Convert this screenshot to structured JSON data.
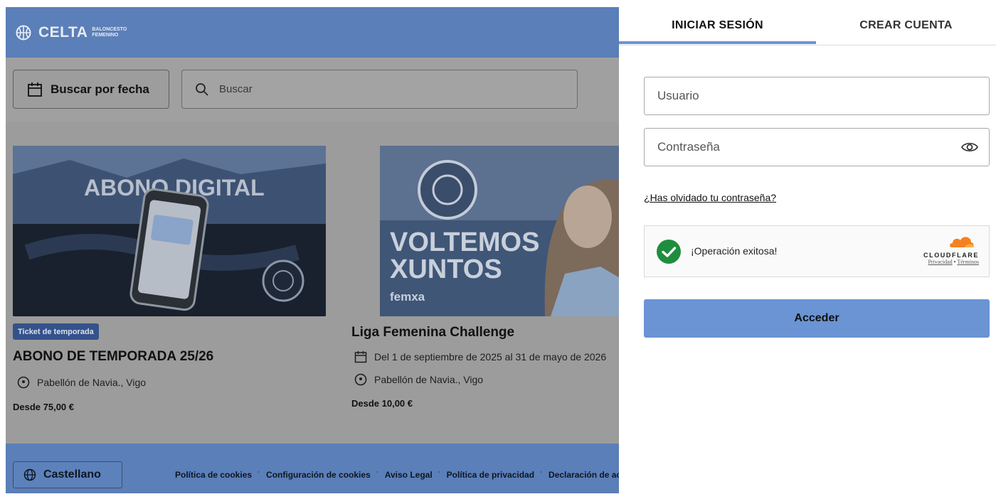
{
  "header": {
    "logo_word": "CELTA",
    "logo_sub1": "BALONCESTO",
    "logo_sub2": "FEMENINO"
  },
  "search": {
    "date_button": "Buscar por fecha",
    "placeholder": "Buscar"
  },
  "card1": {
    "image_text": "ABONO DIGITAL",
    "badge": "Ticket de temporada",
    "title": "ABONO DE TEMPORADA 25/26",
    "location": "Pabellón de Navia., Vigo",
    "price": "Desde 75,00 €"
  },
  "card2": {
    "image_text1": "VOLTEMOS",
    "image_text2": "XUNTOS",
    "image_brand": "femxa",
    "title": "Liga Femenina Challenge",
    "dates": "Del 1 de septiembre de 2025 al 31 de mayo de 2026",
    "location": "Pabellón de Navia., Vigo",
    "price": "Desde 10,00 €"
  },
  "footer": {
    "language": "Castellano",
    "links": [
      "Política de cookies",
      "Configuración de cookies",
      "Aviso Legal",
      "Política de privacidad",
      "Declaración de accesibilidad"
    ],
    "separator": "˙"
  },
  "panel": {
    "tab_login": "INICIAR SESIÓN",
    "tab_register": "CREAR CUENTA",
    "username_placeholder": "Usuario",
    "password_placeholder": "Contraseña",
    "forgot_prefix": "¿",
    "forgot_link": "Has olvidado tu contraseña?",
    "captcha_status": "¡Operación exitosa!",
    "captcha_brand": "CLOUDFLARE",
    "captcha_privacy": "Privacidad",
    "captcha_dot": "•",
    "captcha_terms": "Términos",
    "submit": "Acceder"
  },
  "colors": {
    "overlay_header": "#5b7fb8",
    "accent": "#6a94d4",
    "success": "#1e8e3e",
    "cloudflare_orange": "#f48120"
  }
}
